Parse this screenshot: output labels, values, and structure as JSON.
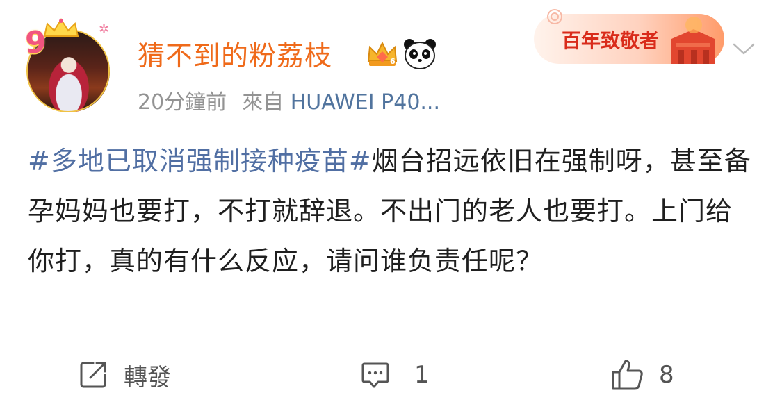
{
  "post": {
    "username": "猜不到的粉荔枝",
    "time": "20分鐘前",
    "source_prefix": "來自",
    "source_device": "HUAWEI P40...",
    "hashtag": "#多地已取消强制接种疫苗#",
    "body_text": "烟台招远依旧在强制呀，甚至备孕妈妈也要打，不打就辞退。不出门的老人也要打。上门给你打，真的有什么反应，请问谁负责任呢？",
    "avatar_badge": "9"
  },
  "banner": {
    "text": "百年致敬者"
  },
  "actions": {
    "repost_label": "轉發",
    "comment_count": "1",
    "like_count": "8"
  },
  "colors": {
    "username": "#ef6a1a",
    "hashtag": "#516fa3",
    "device": "#51749e",
    "meta": "#939393",
    "body": "#1f1f1f",
    "banner": "#e8452f"
  },
  "icons": [
    "vip-crown-icon",
    "panda-icon",
    "chevron-down-icon",
    "repost-icon",
    "comment-icon",
    "like-icon"
  ]
}
